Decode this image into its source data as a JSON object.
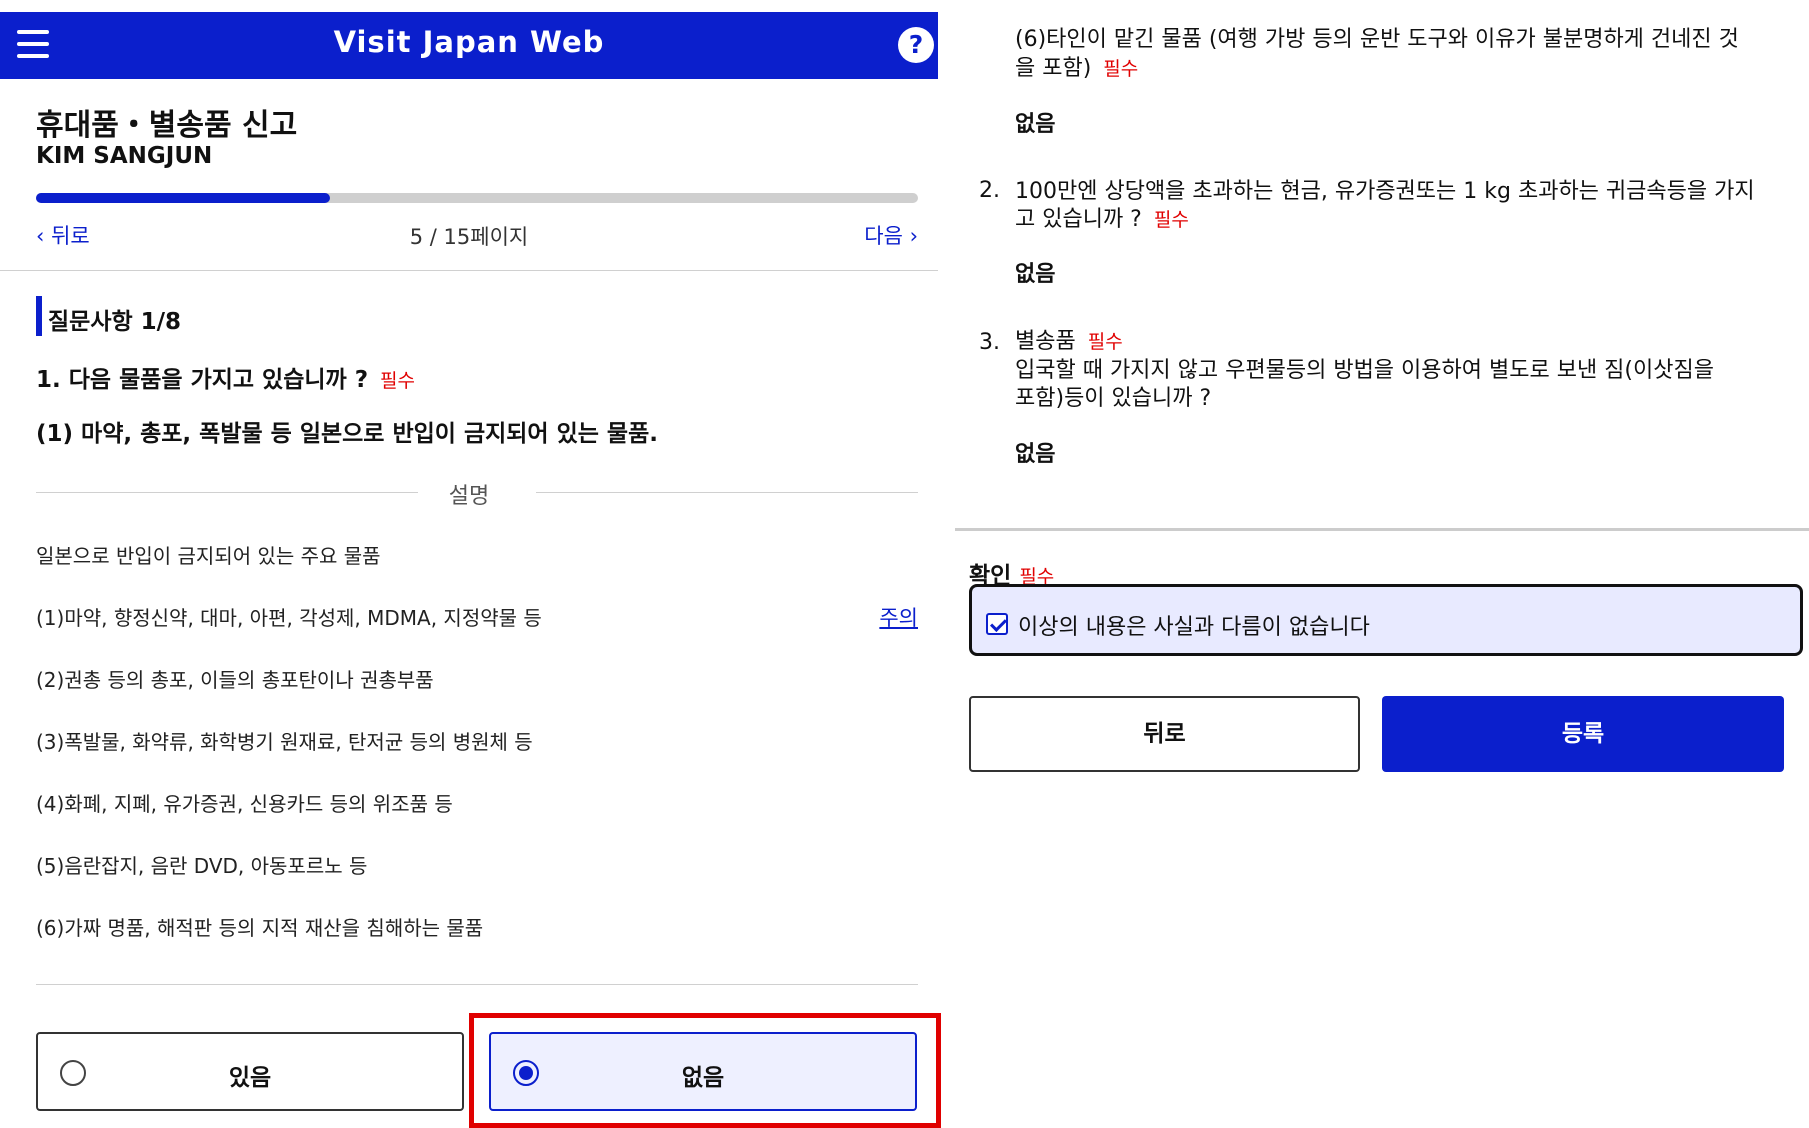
{
  "header": {
    "app_title": "Visit Japan Web",
    "menu_icon": "hamburger-menu-icon",
    "help_icon": "help-icon",
    "help_glyph": "?"
  },
  "page": {
    "heading": "휴대품・별송품 신고",
    "user_name": "KIM SANGJUN",
    "progress_fraction": 0.333
  },
  "nav": {
    "back_label": "뒤로",
    "page_indicator": "5 / 15페이지",
    "next_label": "다음"
  },
  "question": {
    "section_title": "질문사항 1/8",
    "main": "1. 다음 물품을 가지고 있습니까 ?",
    "required": "필수",
    "sub": "(1) 마약, 총포, 폭발물 등 일본으로 반입이 금지되어 있는 물품.",
    "explanation_label": "설명",
    "intro": "일본으로 반입이 금지되어 있는 주요 물품",
    "items": [
      "(1)마약, 향정신약, 대마, 아편, 각성제, MDMA, 지정약물 등",
      "(2)권총 등의 총포, 이들의 총포탄이나 권총부품",
      "(3)폭발물, 화약류, 화학병기 원재료, 탄저균 등의 병원체 등",
      "(4)화폐, 지폐, 유가증권, 신용카드 등의 위조품 등",
      "(5)음란잡지, 음란 DVD, 아동포르노 등",
      "(6)가짜 명품, 해적판 등의 지적 재산을 침해하는 물품"
    ],
    "note_link": "주의",
    "choices": {
      "yes": "있음",
      "no": "없음",
      "selected": "no"
    }
  },
  "summary": {
    "item6_line1": "(6)타인이 맡긴 물품 (여행 가방 등의 운반 도구와 이유가 불분명하게 건네진 것",
    "item6_line2": "을 포함)",
    "item6_required": "필수",
    "item6_answer": "없음",
    "q2_number": "2.",
    "q2_line1": "100만엔 상당액을 초과하는 현금, 유가증권또는 1 kg 초과하는 귀금속등을 가지",
    "q2_line2": "고 있습니까 ?",
    "q2_required": "필수",
    "q2_answer": "없음",
    "q3_number": "3.",
    "q3_title": "별송품",
    "q3_required": "필수",
    "q3_line1": "입국할 때 가지지 않고 우편물등의 방법을 이용하여 별도로 보낸 짐(이삿짐을",
    "q3_line2": "포함)등이 있습니까 ?",
    "q3_answer": "없음"
  },
  "confirm": {
    "title": "확인",
    "required": "필수",
    "checkbox_label": "이상의 내용은 사실과 다름이 없습니다",
    "checked": true
  },
  "actions": {
    "back_label": "뒤로",
    "submit_label": "등록"
  },
  "colors": {
    "brand_blue": "#0b1fcc",
    "required_red": "#e00000",
    "highlight_red": "#e00000"
  }
}
